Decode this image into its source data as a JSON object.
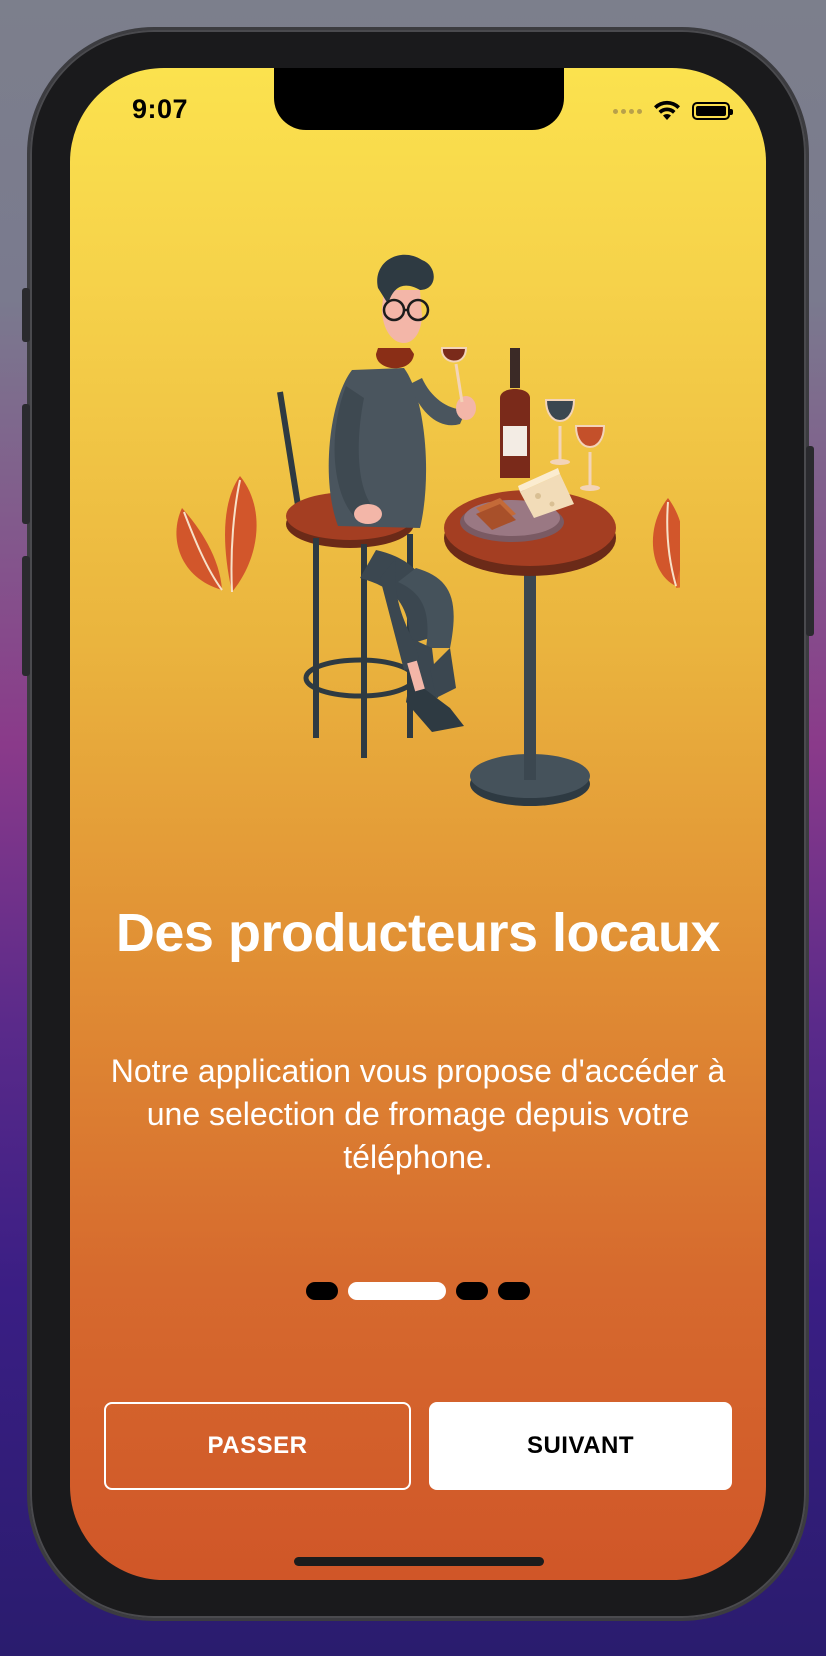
{
  "status_bar": {
    "time": "9:07",
    "icons": [
      "cellular-signal-icon",
      "wifi-icon",
      "battery-icon"
    ]
  },
  "onboarding": {
    "title": "Des producteurs locaux",
    "description": "Notre application vous propose d'accéder à une selection de fromage depuis votre téléphone.",
    "page_count": 4,
    "current_page": 2
  },
  "buttons": {
    "skip_label": "PASSER",
    "next_label": "SUIVANT"
  },
  "colors": {
    "gradient_top": "#fbe24e",
    "gradient_bottom": "#d05628",
    "accent": "#d05628",
    "text": "#ffffff"
  }
}
